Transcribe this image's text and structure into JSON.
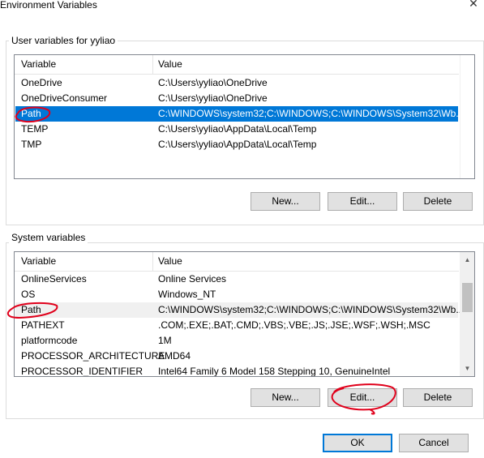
{
  "window": {
    "title": "Environment Variables",
    "close_glyph": "✕"
  },
  "user_section": {
    "label": "User variables for yyliao",
    "columns": {
      "variable": "Variable",
      "value": "Value"
    },
    "rows": [
      {
        "variable": "OneDrive",
        "value": "C:\\Users\\yyliao\\OneDrive"
      },
      {
        "variable": "OneDriveConsumer",
        "value": "C:\\Users\\yyliao\\OneDrive"
      },
      {
        "variable": "Path",
        "value": "C:\\WINDOWS\\system32;C:\\WINDOWS;C:\\WINDOWS\\System32\\Wb..."
      },
      {
        "variable": "TEMP",
        "value": "C:\\Users\\yyliao\\AppData\\Local\\Temp"
      },
      {
        "variable": "TMP",
        "value": "C:\\Users\\yyliao\\AppData\\Local\\Temp"
      }
    ],
    "selected_row": 2,
    "buttons": {
      "new": "New...",
      "edit": "Edit...",
      "delete": "Delete"
    }
  },
  "system_section": {
    "label": "System variables",
    "columns": {
      "variable": "Variable",
      "value": "Value"
    },
    "rows": [
      {
        "variable": "OnlineServices",
        "value": "Online Services"
      },
      {
        "variable": "OS",
        "value": "Windows_NT"
      },
      {
        "variable": "Path",
        "value": "C:\\WINDOWS\\system32;C:\\WINDOWS;C:\\WINDOWS\\System32\\Wb..."
      },
      {
        "variable": "PATHEXT",
        "value": ".COM;.EXE;.BAT;.CMD;.VBS;.VBE;.JS;.JSE;.WSF;.WSH;.MSC"
      },
      {
        "variable": "platformcode",
        "value": "1M"
      },
      {
        "variable": "PROCESSOR_ARCHITECTURE",
        "value": "AMD64"
      },
      {
        "variable": "PROCESSOR_IDENTIFIER",
        "value": "Intel64 Family 6 Model 158 Stepping 10, GenuineIntel"
      }
    ],
    "selected_row": 2,
    "scrollbar": {
      "up_glyph": "▲",
      "down_glyph": "▼"
    },
    "buttons": {
      "new": "New...",
      "edit": "Edit...",
      "delete": "Delete"
    }
  },
  "footer": {
    "ok": "OK",
    "cancel": "Cancel"
  },
  "colors": {
    "selection": "#0078d7",
    "annotation": "#e0001b"
  }
}
